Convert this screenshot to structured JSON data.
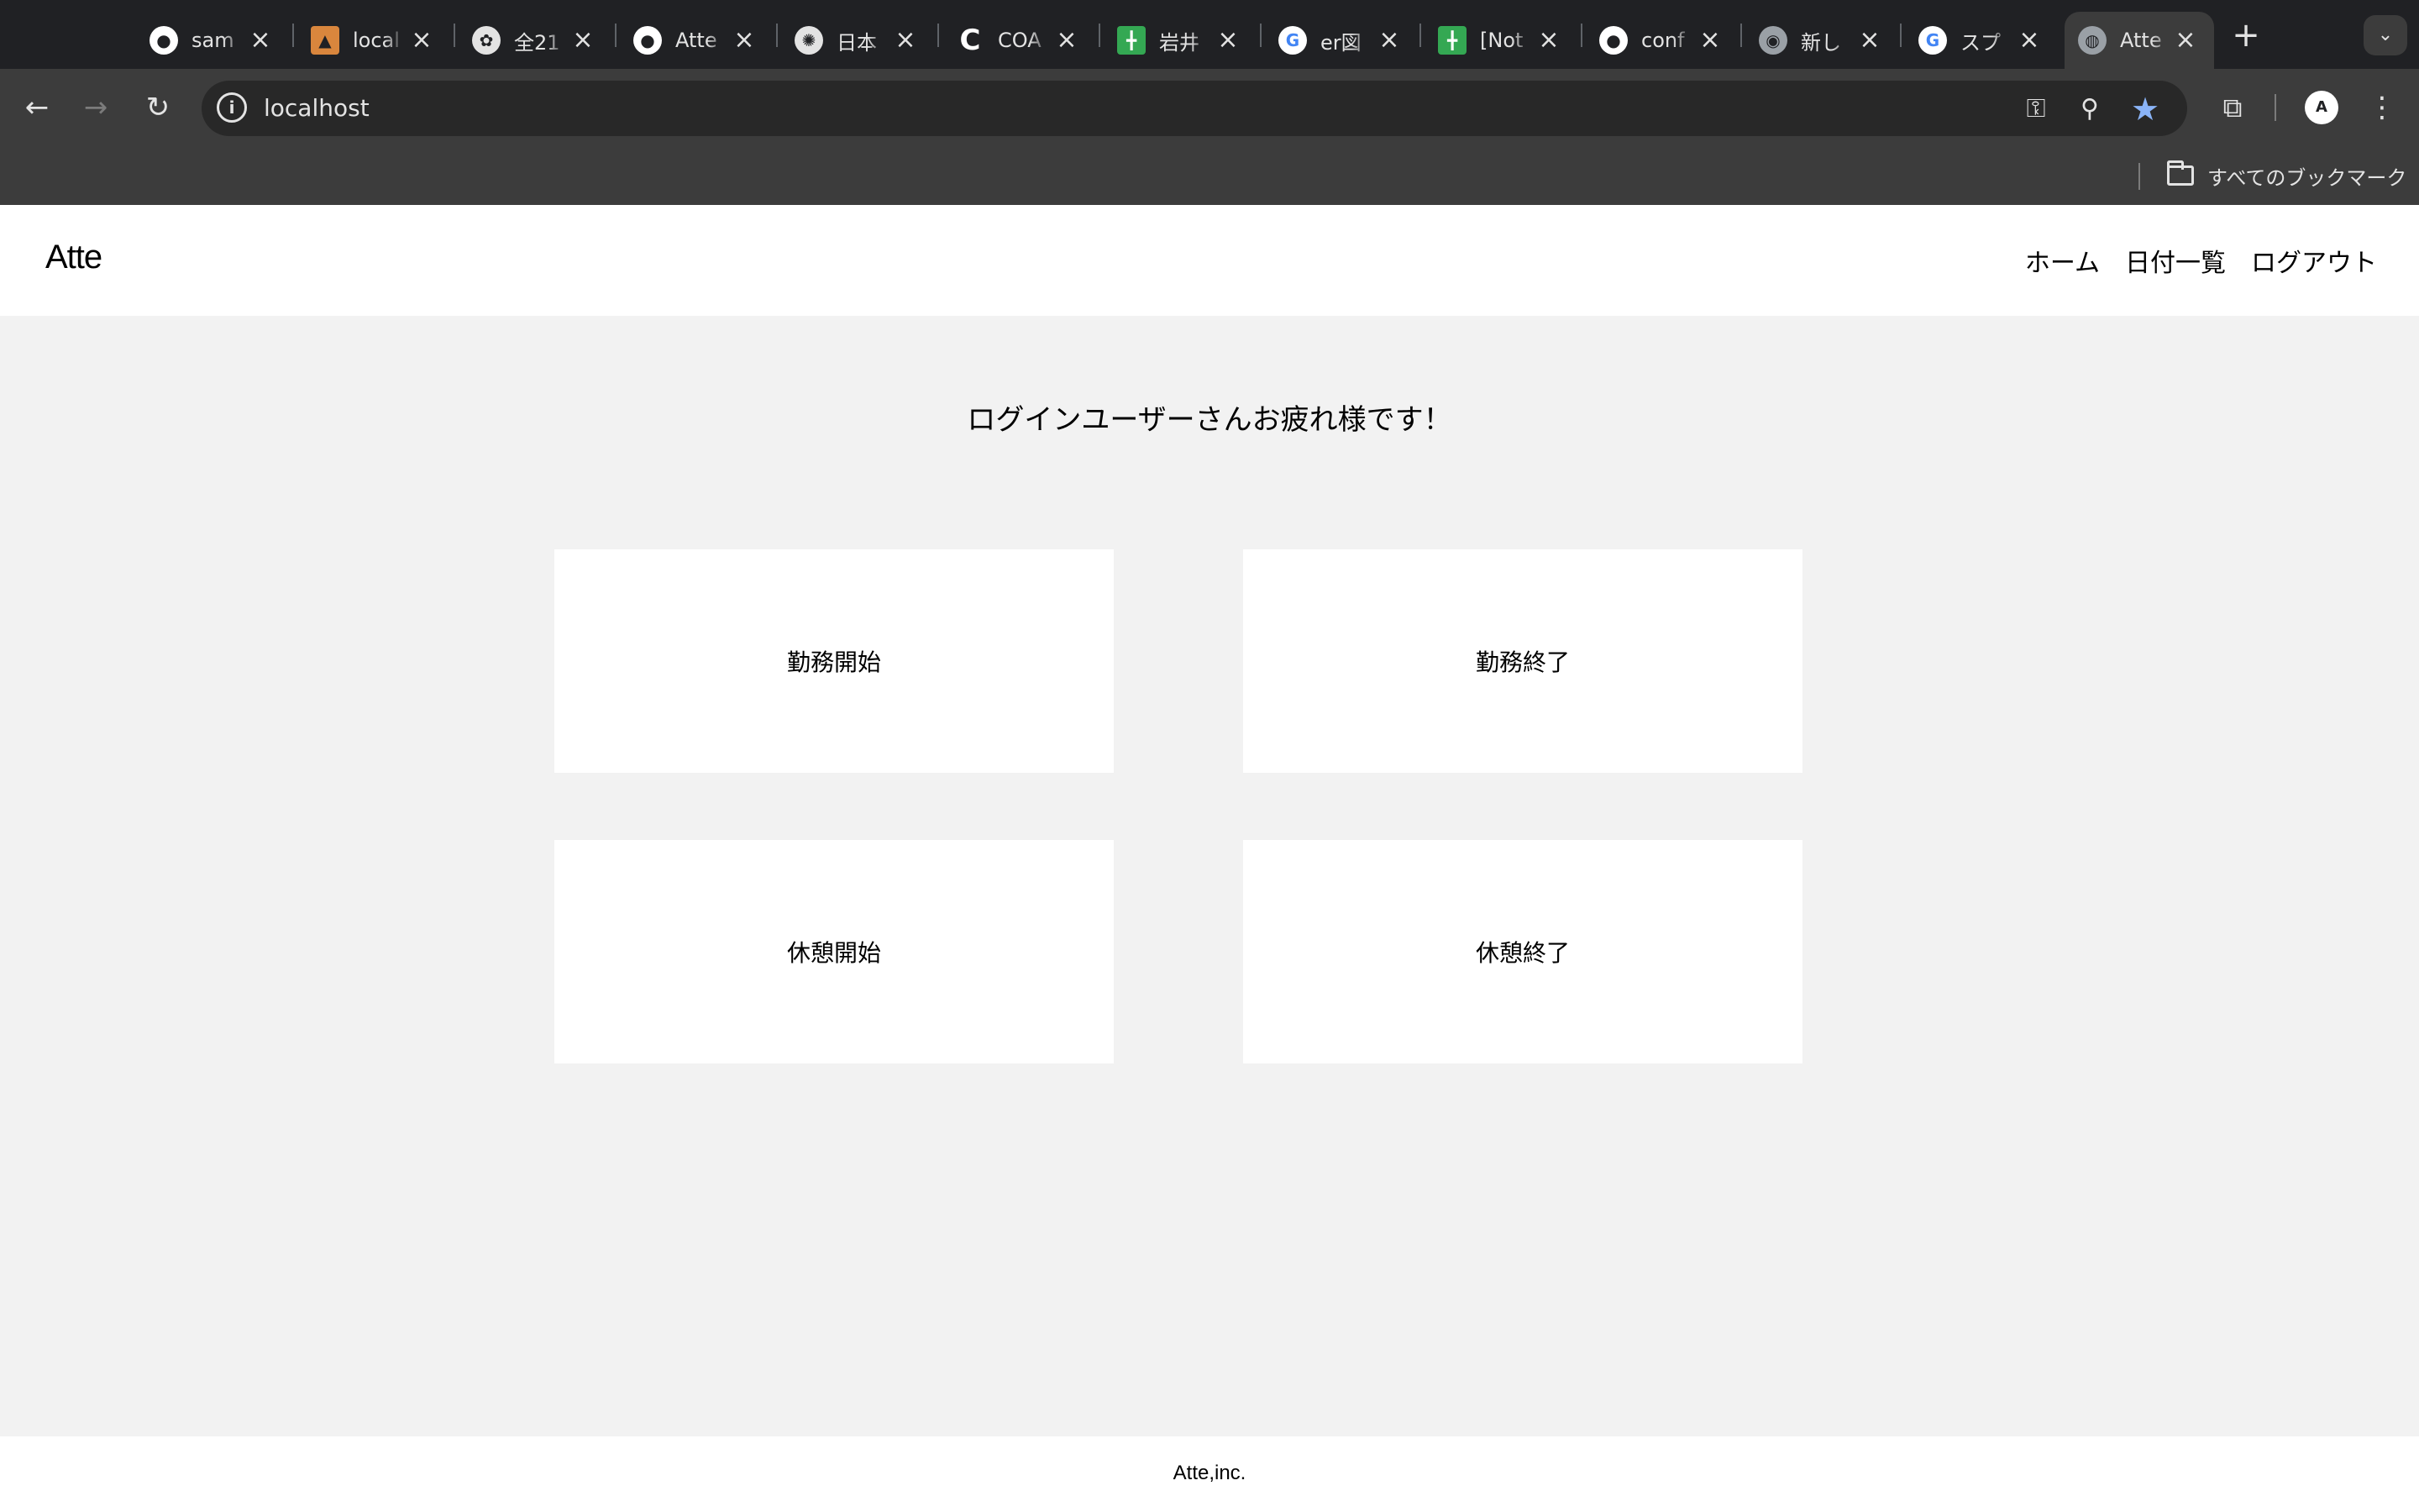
{
  "browser": {
    "tabs": [
      {
        "title": "sam",
        "icon": "github-icon"
      },
      {
        "title": "local",
        "icon": "app-icon"
      },
      {
        "title": "全21",
        "icon": "app-icon"
      },
      {
        "title": "Atte",
        "icon": "github-icon"
      },
      {
        "title": "日本",
        "icon": "openai-icon"
      },
      {
        "title": "COA",
        "icon": "coachtech-icon"
      },
      {
        "title": "岩井",
        "icon": "sheets-icon"
      },
      {
        "title": "er図",
        "icon": "google-icon"
      },
      {
        "title": "[Not",
        "icon": "sheets-icon"
      },
      {
        "title": "conf",
        "icon": "github-icon"
      },
      {
        "title": "新し",
        "icon": "chrome-icon"
      },
      {
        "title": "スプ",
        "icon": "google-icon"
      },
      {
        "title": "Atte",
        "icon": "globe-icon",
        "active": true
      }
    ],
    "address": "localhost",
    "bookmarks_all_label": "すべてのブックマーク",
    "colors": {
      "titlebar": "#202124",
      "toolbar": "#3c3c3c",
      "omnibox": "#282828",
      "star": "#8ab4f8"
    }
  },
  "site": {
    "logo": "Atte",
    "nav": {
      "home": "ホーム",
      "dates": "日付一覧",
      "logout": "ログアウト"
    },
    "greeting": "ログインユーザーさんお疲れ様です！",
    "actions": {
      "work_start": "勤務開始",
      "work_end": "勤務終了",
      "break_start": "休憩開始",
      "break_end": "休憩終了"
    },
    "footer": "Atte,inc.",
    "colors": {
      "page_bg": "#f2f2f2",
      "card_bg": "#ffffff",
      "text": "#000000"
    }
  }
}
